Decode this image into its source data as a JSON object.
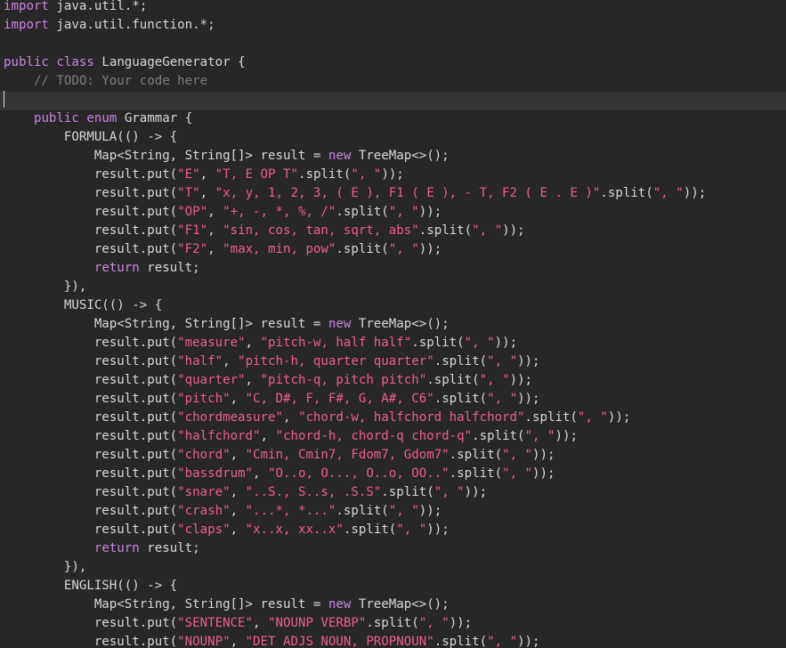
{
  "editor": {
    "current_line": 5,
    "colors": {
      "background": "#272727",
      "current_line": "#353535",
      "text": "#d8d8d8",
      "keyword": "#c986e0",
      "string": "#ee5e8f",
      "comment": "#7e7e7e"
    },
    "lines": [
      [
        [
          "kw",
          "import"
        ],
        [
          "tx",
          " java.util.*;"
        ]
      ],
      [
        [
          "kw",
          "import"
        ],
        [
          "tx",
          " java.util.function.*;"
        ]
      ],
      [],
      [
        [
          "kw",
          "public"
        ],
        [
          "tx",
          " "
        ],
        [
          "kw",
          "class"
        ],
        [
          "tx",
          " LanguageGenerator {"
        ]
      ],
      [
        [
          "cm",
          "    // TODO: Your code here"
        ]
      ],
      [],
      [
        [
          "tx",
          "    "
        ],
        [
          "kw",
          "public"
        ],
        [
          "tx",
          " "
        ],
        [
          "kw",
          "enum"
        ],
        [
          "tx",
          " Grammar {"
        ]
      ],
      [
        [
          "tx",
          "        FORMULA(() -> {"
        ]
      ],
      [
        [
          "tx",
          "            Map<String, String[]> result = "
        ],
        [
          "kw",
          "new"
        ],
        [
          "tx",
          " TreeMap<>();"
        ]
      ],
      [
        [
          "tx",
          "            result.put("
        ],
        [
          "str",
          "\"E\""
        ],
        [
          "tx",
          ", "
        ],
        [
          "str",
          "\"T, E OP T\""
        ],
        [
          "tx",
          ".split("
        ],
        [
          "str",
          "\", \""
        ],
        [
          "tx",
          "));"
        ]
      ],
      [
        [
          "tx",
          "            result.put("
        ],
        [
          "str",
          "\"T\""
        ],
        [
          "tx",
          ", "
        ],
        [
          "str",
          "\"x, y, 1, 2, 3, ( E ), F1 ( E ), - T, F2 ( E . E )\""
        ],
        [
          "tx",
          ".split("
        ],
        [
          "str",
          "\", \""
        ],
        [
          "tx",
          "));"
        ]
      ],
      [
        [
          "tx",
          "            result.put("
        ],
        [
          "str",
          "\"OP\""
        ],
        [
          "tx",
          ", "
        ],
        [
          "str",
          "\"+, -, *, %, /\""
        ],
        [
          "tx",
          ".split("
        ],
        [
          "str",
          "\", \""
        ],
        [
          "tx",
          "));"
        ]
      ],
      [
        [
          "tx",
          "            result.put("
        ],
        [
          "str",
          "\"F1\""
        ],
        [
          "tx",
          ", "
        ],
        [
          "str",
          "\"sin, cos, tan, sqrt, abs\""
        ],
        [
          "tx",
          ".split("
        ],
        [
          "str",
          "\", \""
        ],
        [
          "tx",
          "));"
        ]
      ],
      [
        [
          "tx",
          "            result.put("
        ],
        [
          "str",
          "\"F2\""
        ],
        [
          "tx",
          ", "
        ],
        [
          "str",
          "\"max, min, pow\""
        ],
        [
          "tx",
          ".split("
        ],
        [
          "str",
          "\", \""
        ],
        [
          "tx",
          "));"
        ]
      ],
      [
        [
          "tx",
          "            "
        ],
        [
          "kw",
          "return"
        ],
        [
          "tx",
          " result;"
        ]
      ],
      [
        [
          "tx",
          "        }),"
        ]
      ],
      [
        [
          "tx",
          "        MUSIC(() -> {"
        ]
      ],
      [
        [
          "tx",
          "            Map<String, String[]> result = "
        ],
        [
          "kw",
          "new"
        ],
        [
          "tx",
          " TreeMap<>();"
        ]
      ],
      [
        [
          "tx",
          "            result.put("
        ],
        [
          "str",
          "\"measure\""
        ],
        [
          "tx",
          ", "
        ],
        [
          "str",
          "\"pitch-w, half half\""
        ],
        [
          "tx",
          ".split("
        ],
        [
          "str",
          "\", \""
        ],
        [
          "tx",
          "));"
        ]
      ],
      [
        [
          "tx",
          "            result.put("
        ],
        [
          "str",
          "\"half\""
        ],
        [
          "tx",
          ", "
        ],
        [
          "str",
          "\"pitch-h, quarter quarter\""
        ],
        [
          "tx",
          ".split("
        ],
        [
          "str",
          "\", \""
        ],
        [
          "tx",
          "));"
        ]
      ],
      [
        [
          "tx",
          "            result.put("
        ],
        [
          "str",
          "\"quarter\""
        ],
        [
          "tx",
          ", "
        ],
        [
          "str",
          "\"pitch-q, pitch pitch\""
        ],
        [
          "tx",
          ".split("
        ],
        [
          "str",
          "\", \""
        ],
        [
          "tx",
          "));"
        ]
      ],
      [
        [
          "tx",
          "            result.put("
        ],
        [
          "str",
          "\"pitch\""
        ],
        [
          "tx",
          ", "
        ],
        [
          "str",
          "\"C, D#, F, F#, G, A#, C6\""
        ],
        [
          "tx",
          ".split("
        ],
        [
          "str",
          "\", \""
        ],
        [
          "tx",
          "));"
        ]
      ],
      [
        [
          "tx",
          "            result.put("
        ],
        [
          "str",
          "\"chordmeasure\""
        ],
        [
          "tx",
          ", "
        ],
        [
          "str",
          "\"chord-w, halfchord halfchord\""
        ],
        [
          "tx",
          ".split("
        ],
        [
          "str",
          "\", \""
        ],
        [
          "tx",
          "));"
        ]
      ],
      [
        [
          "tx",
          "            result.put("
        ],
        [
          "str",
          "\"halfchord\""
        ],
        [
          "tx",
          ", "
        ],
        [
          "str",
          "\"chord-h, chord-q chord-q\""
        ],
        [
          "tx",
          ".split("
        ],
        [
          "str",
          "\", \""
        ],
        [
          "tx",
          "));"
        ]
      ],
      [
        [
          "tx",
          "            result.put("
        ],
        [
          "str",
          "\"chord\""
        ],
        [
          "tx",
          ", "
        ],
        [
          "str",
          "\"Cmin, Cmin7, Fdom7, Gdom7\""
        ],
        [
          "tx",
          ".split("
        ],
        [
          "str",
          "\", \""
        ],
        [
          "tx",
          "));"
        ]
      ],
      [
        [
          "tx",
          "            result.put("
        ],
        [
          "str",
          "\"bassdrum\""
        ],
        [
          "tx",
          ", "
        ],
        [
          "str",
          "\"O..o, O..., O..o, OO..\""
        ],
        [
          "tx",
          ".split("
        ],
        [
          "str",
          "\", \""
        ],
        [
          "tx",
          "));"
        ]
      ],
      [
        [
          "tx",
          "            result.put("
        ],
        [
          "str",
          "\"snare\""
        ],
        [
          "tx",
          ", "
        ],
        [
          "str",
          "\"..S., S..s, .S.S\""
        ],
        [
          "tx",
          ".split("
        ],
        [
          "str",
          "\", \""
        ],
        [
          "tx",
          "));"
        ]
      ],
      [
        [
          "tx",
          "            result.put("
        ],
        [
          "str",
          "\"crash\""
        ],
        [
          "tx",
          ", "
        ],
        [
          "str",
          "\"...*, *...\""
        ],
        [
          "tx",
          ".split("
        ],
        [
          "str",
          "\", \""
        ],
        [
          "tx",
          "));"
        ]
      ],
      [
        [
          "tx",
          "            result.put("
        ],
        [
          "str",
          "\"claps\""
        ],
        [
          "tx",
          ", "
        ],
        [
          "str",
          "\"x..x, xx..x\""
        ],
        [
          "tx",
          ".split("
        ],
        [
          "str",
          "\", \""
        ],
        [
          "tx",
          "));"
        ]
      ],
      [
        [
          "tx",
          "            "
        ],
        [
          "kw",
          "return"
        ],
        [
          "tx",
          " result;"
        ]
      ],
      [
        [
          "tx",
          "        }),"
        ]
      ],
      [
        [
          "tx",
          "        ENGLISH(() -> {"
        ]
      ],
      [
        [
          "tx",
          "            Map<String, String[]> result = "
        ],
        [
          "kw",
          "new"
        ],
        [
          "tx",
          " TreeMap<>();"
        ]
      ],
      [
        [
          "tx",
          "            result.put("
        ],
        [
          "str",
          "\"SENTENCE\""
        ],
        [
          "tx",
          ", "
        ],
        [
          "str",
          "\"NOUNP VERBP\""
        ],
        [
          "tx",
          ".split("
        ],
        [
          "str",
          "\", \""
        ],
        [
          "tx",
          "));"
        ]
      ],
      [
        [
          "tx",
          "            result.put("
        ],
        [
          "str",
          "\"NOUNP\""
        ],
        [
          "tx",
          ", "
        ],
        [
          "str",
          "\"DET ADJS NOUN, PROPNOUN\""
        ],
        [
          "tx",
          ".split("
        ],
        [
          "str",
          "\", \""
        ],
        [
          "tx",
          "));"
        ]
      ]
    ]
  }
}
